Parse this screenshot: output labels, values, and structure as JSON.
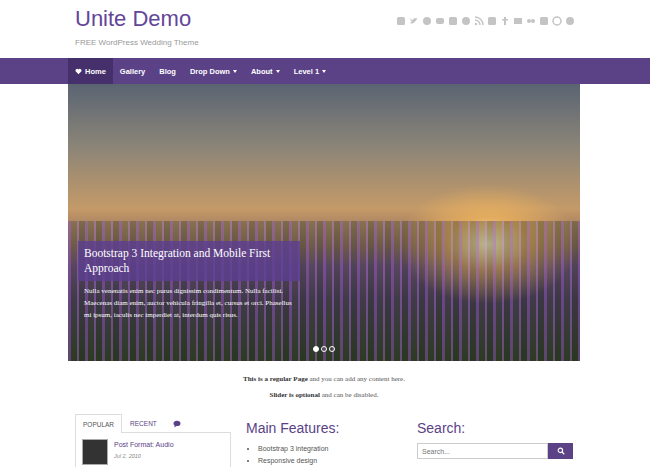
{
  "site": {
    "title": "Unite Demo",
    "tagline": "FREE WordPress Wedding Theme"
  },
  "nav": {
    "items": [
      {
        "label": "Home",
        "selected": true,
        "dropdown": false
      },
      {
        "label": "Gallery",
        "selected": false,
        "dropdown": false
      },
      {
        "label": "Blog",
        "selected": false,
        "dropdown": false
      },
      {
        "label": "Drop Down",
        "selected": false,
        "dropdown": true
      },
      {
        "label": "About",
        "selected": false,
        "dropdown": true
      },
      {
        "label": "Level 1",
        "selected": false,
        "dropdown": true
      }
    ]
  },
  "slider": {
    "caption_title": "Bootstrap 3 Integration and Mobile First Approach",
    "caption_text": "Nulla venenatis enim nec purus dignissim condimentum. Nulla facilisi. Maecenas diam enim, auctor vehicula fringilla et, cursus et orci. Phasellus mi ipsum, iaculis nec imperdiet at, interdum quis risus.",
    "dots": [
      {
        "selected": true
      },
      {
        "selected": false
      },
      {
        "selected": false
      }
    ]
  },
  "intro": [
    {
      "bold": "This is a regular Page",
      "rest": " and you can add any content here."
    },
    {
      "bold": "Slider is optional",
      "rest": " and can be disabled."
    }
  ],
  "widget_tabs": {
    "tabs": [
      {
        "kind": "text",
        "label": "POPULAR",
        "selected": true
      },
      {
        "kind": "text",
        "label": "RECENT",
        "selected": false
      },
      {
        "kind": "icon",
        "selected": false
      }
    ],
    "posts": [
      {
        "title": "Post Format: Audio",
        "date": "Jul 2, 2010"
      }
    ]
  },
  "features": {
    "title": "Main Features:",
    "items": [
      "Bootstrap 3 integration",
      "Responsive design"
    ]
  },
  "search": {
    "title": "Search:",
    "placeholder": "Search..."
  }
}
